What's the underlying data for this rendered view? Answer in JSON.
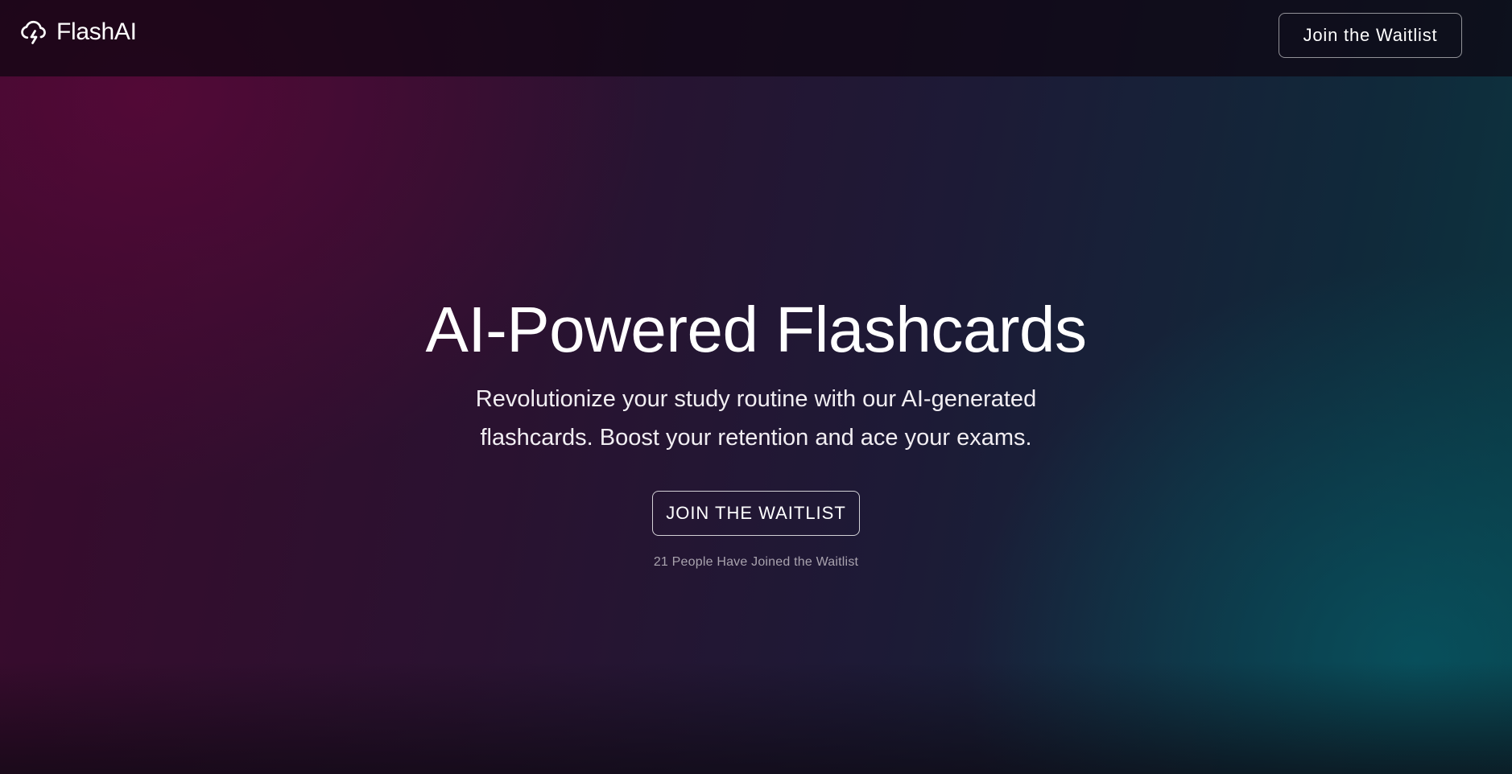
{
  "header": {
    "brand_name": "FlashAI",
    "brand_icon": "cloud-lightning-icon",
    "cta_label": "Join the Waitlist"
  },
  "hero": {
    "title": "AI-Powered Flashcards",
    "subtitle": "Revolutionize your study routine with our AI-generated flashcards. Boost your retention and ace your exams.",
    "cta_label": "JOIN THE WAITLIST",
    "waitlist_count_text": "21 People Have Joined the Waitlist"
  },
  "colors": {
    "background_left": "#3a0a2c",
    "background_right": "#0b3640",
    "text": "#ffffff",
    "muted_text": "#a9a3ae"
  }
}
